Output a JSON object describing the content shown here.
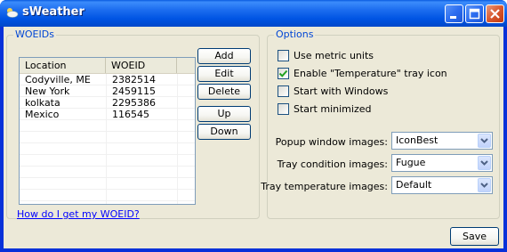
{
  "window": {
    "title": "sWeather",
    "controls": [
      "minimize",
      "maximize",
      "close"
    ]
  },
  "woeids": {
    "group_label": "WOEIDs",
    "columns": [
      "Location",
      "WOEID"
    ],
    "rows": [
      {
        "location": "Codyville, ME",
        "woeid": "2382514"
      },
      {
        "location": "New York",
        "woeid": "2459115"
      },
      {
        "location": "kolkata",
        "woeid": "2295386"
      },
      {
        "location": "Mexico",
        "woeid": "116545"
      }
    ],
    "buttons": {
      "add": "Add",
      "edit": "Edit",
      "delete": "Delete",
      "up": "Up",
      "down": "Down"
    },
    "help_link": "How do I get my WOEID?"
  },
  "options": {
    "group_label": "Options",
    "checkboxes": [
      {
        "label": "Use metric units",
        "checked": false
      },
      {
        "label": "Enable \"Temperature\" tray icon",
        "checked": true
      },
      {
        "label": "Start with Windows",
        "checked": false
      },
      {
        "label": "Start minimized",
        "checked": false
      }
    ],
    "selects": [
      {
        "label": "Popup window images:",
        "value": "IconBest"
      },
      {
        "label": "Tray condition images:",
        "value": "Fugue"
      },
      {
        "label": "Tray temperature images:",
        "value": "Default"
      }
    ]
  },
  "footer": {
    "save_label": "Save"
  },
  "colors": {
    "titlebar": "#0054e3",
    "group_label": "#0046d5",
    "link": "#0000ff",
    "client_bg": "#ece9d8"
  }
}
